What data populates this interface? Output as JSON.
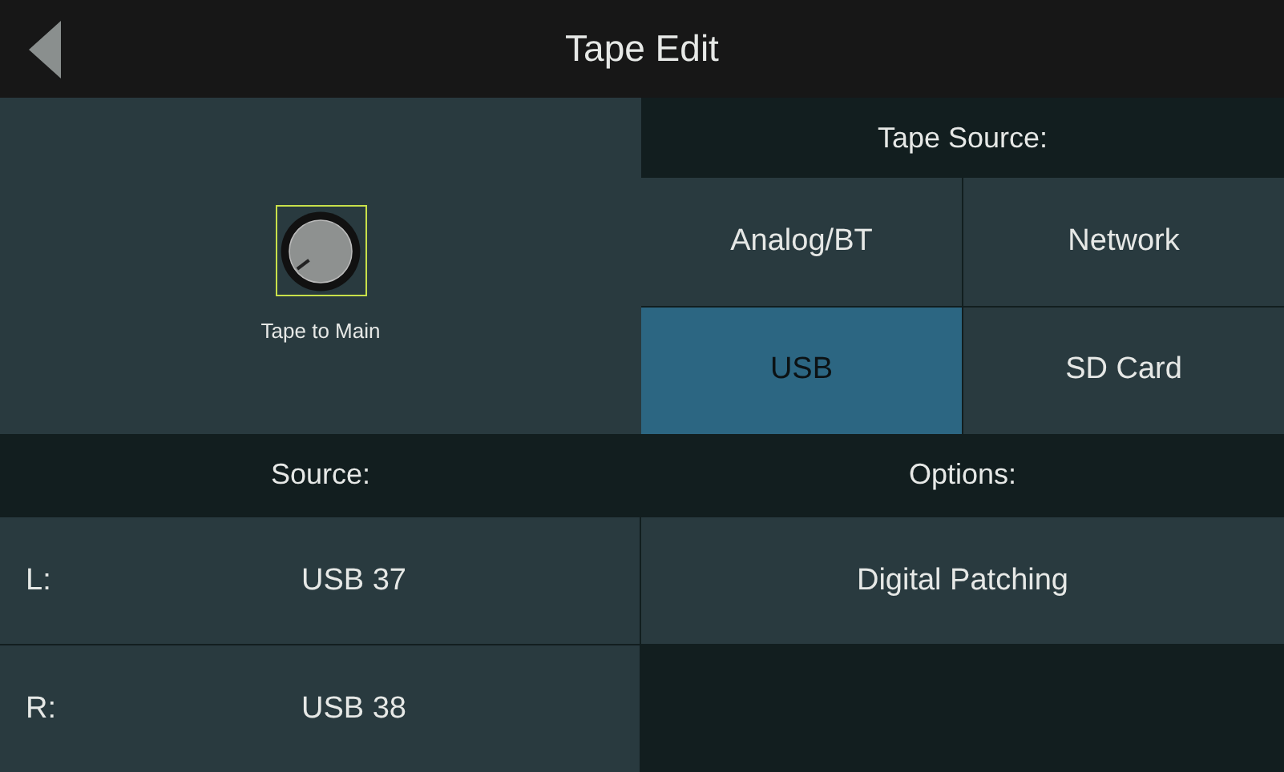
{
  "header": {
    "title": "Tape Edit"
  },
  "knob": {
    "label": "Tape to Main",
    "selected": true
  },
  "tape_source": {
    "heading": "Tape Source:",
    "options": [
      {
        "label": "Analog/BT",
        "selected": false
      },
      {
        "label": "Network",
        "selected": false
      },
      {
        "label": "USB",
        "selected": true
      },
      {
        "label": "SD Card",
        "selected": false
      }
    ]
  },
  "source": {
    "heading": "Source:",
    "rows": [
      {
        "channel": "L:",
        "value": "USB 37"
      },
      {
        "channel": "R:",
        "value": "USB 38"
      }
    ]
  },
  "options": {
    "heading": "Options:",
    "buttons": [
      "Digital Patching"
    ]
  }
}
